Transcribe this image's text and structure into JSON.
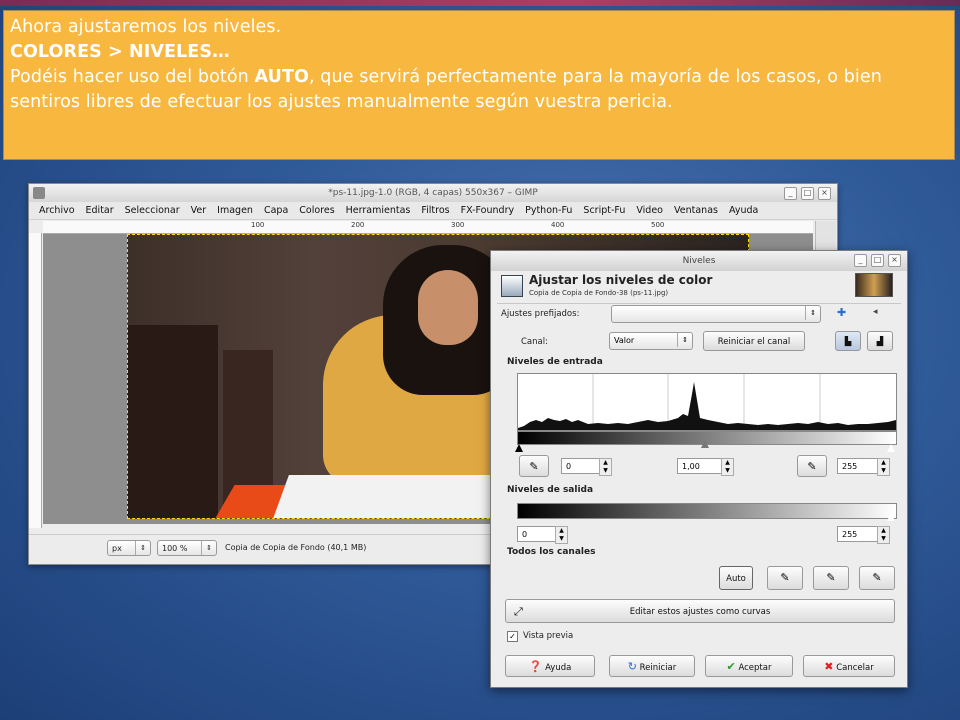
{
  "note": {
    "line1": "Ahora ajustaremos los niveles.",
    "line2": "COLORES > NIVELES…",
    "line3_pre": "Podéis hacer uso del botón ",
    "line3_bold": "AUTO",
    "line3_post": ", que servirá perfectamente para la mayoría de los casos, o bien sentiros libres de efectuar los ajustes manualmente según vuestra pericia."
  },
  "gimp": {
    "title": "*ps-11.jpg-1.0 (RGB, 4 capas) 550x367 – GIMP",
    "menu": [
      "Archivo",
      "Editar",
      "Seleccionar",
      "Ver",
      "Imagen",
      "Capa",
      "Colores",
      "Herramientas",
      "Filtros",
      "FX-Foundry",
      "Python-Fu",
      "Script-Fu",
      "Video",
      "Ventanas",
      "Ayuda"
    ],
    "ruler_marks": [
      "100",
      "200",
      "300",
      "400",
      "500"
    ],
    "status": {
      "unit": "px",
      "zoom": "100 %",
      "text": "Copia de Copia de Fondo (40,1 MB)"
    }
  },
  "levels": {
    "title": "Niveles",
    "heading": "Ajustar los niveles de color",
    "subheading": "Copia de Copia de Fondo-38 (ps-11.jpg)",
    "presets_label": "Ajustes prefijados:",
    "presets_value": "",
    "channel_label": "Canal:",
    "channel_value": "Valor",
    "reset_channel": "Reiniciar el canal",
    "input_levels": "Niveles de entrada",
    "input_low": "0",
    "input_gamma": "1,00",
    "input_high": "255",
    "output_levels": "Niveles de salida",
    "output_low": "0",
    "output_high": "255",
    "all_channels": "Todos los canales",
    "auto": "Auto",
    "curves": "Editar estos ajustes como curvas",
    "preview": "Vista previa",
    "preview_checked": true,
    "help": "Ayuda",
    "reset": "Reiniciar",
    "accept": "Aceptar",
    "cancel": "Cancelar"
  }
}
